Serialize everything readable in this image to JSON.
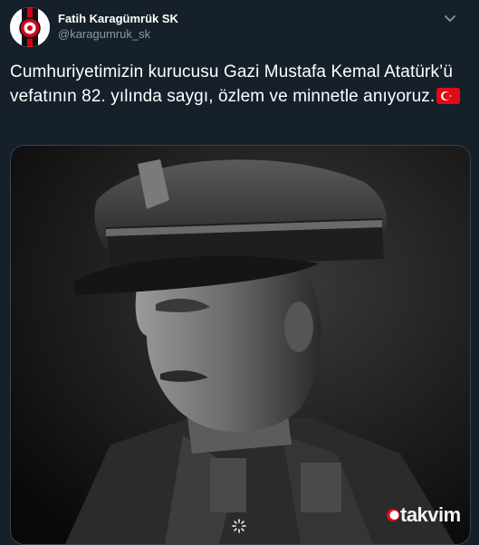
{
  "tweet": {
    "display_name": "Fatih Karagümrük SK",
    "handle": "@karagumruk_sk",
    "text": "Cumhuriyetimizin kurucusu Gazi Mustafa Kemal Atatürk’ü vefatının 82. yılında saygı, özlem ve minnetle anıyoruz.",
    "flag_icon": "turkish-flag-icon"
  },
  "media": {
    "watermark": "takvim",
    "image_icon": "portrait-photo"
  },
  "colors": {
    "background": "#15202b",
    "secondary_text": "#8899a6",
    "flag_red": "#e30a17",
    "club_red": "#d0021b"
  }
}
